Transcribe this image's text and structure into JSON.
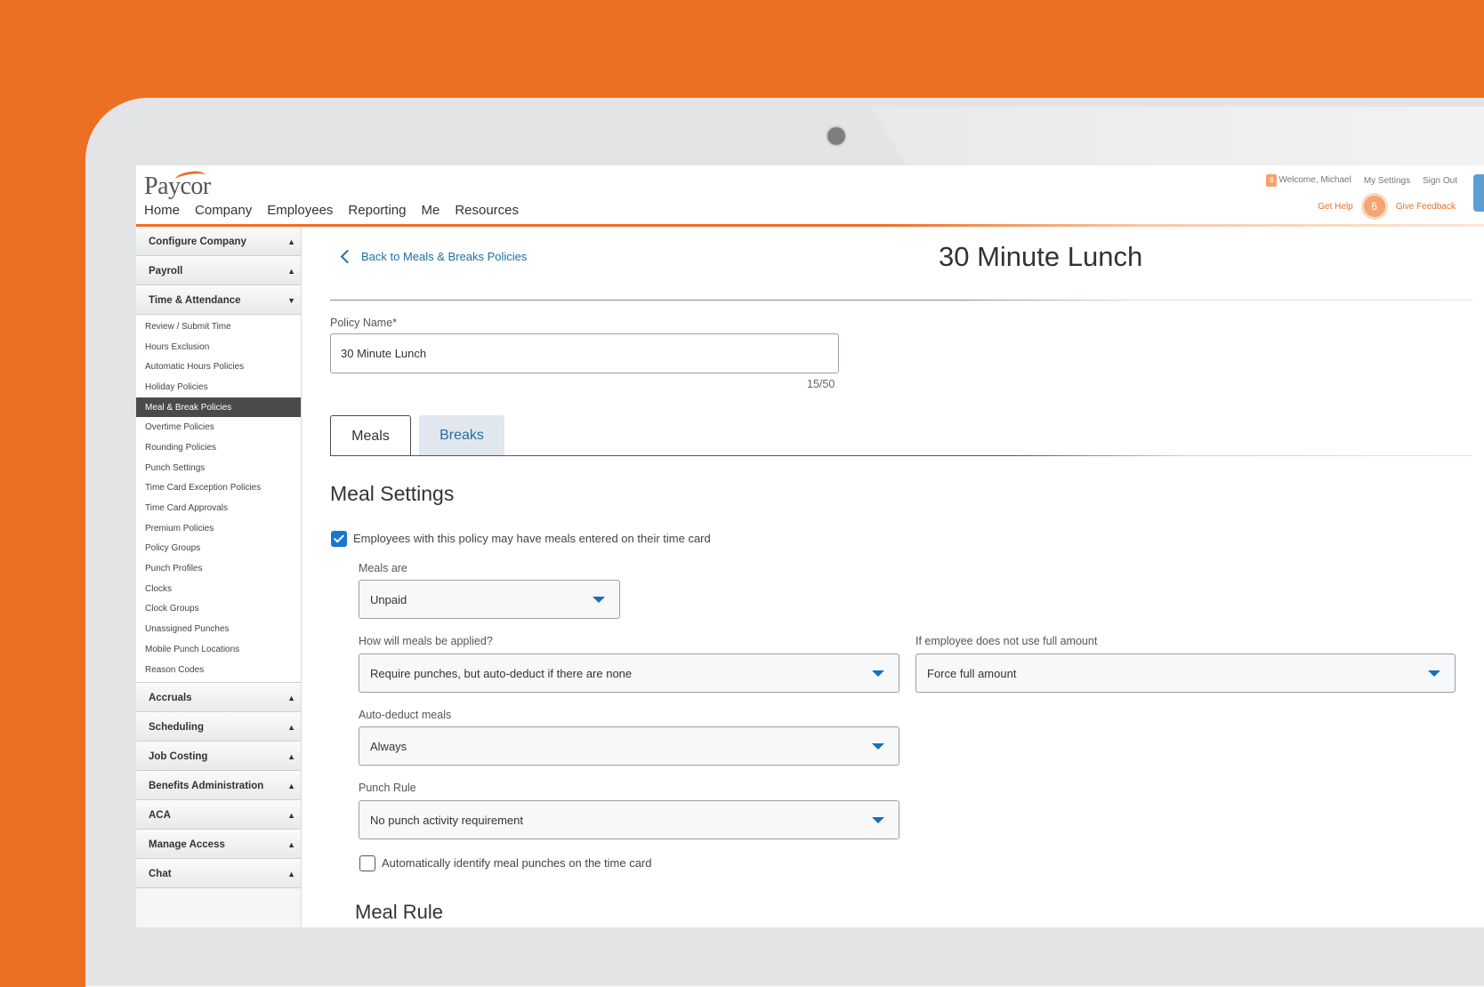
{
  "app": {
    "logo_text": "Paycor",
    "nav": [
      "Home",
      "Company",
      "Employees",
      "Reporting",
      "Me",
      "Resources"
    ],
    "notification_count": "8",
    "welcome": "Welcome, Michael",
    "my_settings": "My Settings",
    "sign_out": "Sign Out",
    "get_help": "Get Help",
    "help_count": "6",
    "give_feedback": "Give Feedback"
  },
  "sidebar": {
    "top_sections": [
      {
        "label": "Configure Company",
        "arrow": "▲"
      },
      {
        "label": "Payroll",
        "arrow": "▲"
      },
      {
        "label": "Time & Attendance",
        "arrow": "▼"
      }
    ],
    "time_items": [
      "Review / Submit Time",
      "Hours Exclusion",
      "Automatic Hours Policies",
      "Holiday Policies",
      "Meal & Break Policies",
      "Overtime Policies",
      "Rounding Policies",
      "Punch Settings",
      "Time Card Exception Policies",
      "Time Card Approvals",
      "Premium Policies",
      "Policy Groups",
      "Punch Profiles",
      "Clocks",
      "Clock Groups",
      "Unassigned Punches",
      "Mobile Punch Locations",
      "Reason Codes"
    ],
    "active_item": "Meal & Break Policies",
    "bottom_sections": [
      {
        "label": "Accruals",
        "arrow": "▲"
      },
      {
        "label": "Scheduling",
        "arrow": "▲"
      },
      {
        "label": "Job Costing",
        "arrow": "▲"
      },
      {
        "label": "Benefits Administration",
        "arrow": "▲"
      },
      {
        "label": "ACA",
        "arrow": "▲"
      },
      {
        "label": "Manage Access",
        "arrow": "▲"
      },
      {
        "label": "Chat",
        "arrow": "▲"
      }
    ]
  },
  "main": {
    "back_link": "Back to Meals & Breaks Policies",
    "title": "30 Minute Lunch",
    "policy_name_label": "Policy Name*",
    "policy_name_value": "30 Minute Lunch",
    "char_count": "15/50",
    "tabs": {
      "meals": "Meals",
      "breaks": "Breaks"
    },
    "meal_settings_heading": "Meal Settings",
    "meals_enabled_label": "Employees with this policy may have meals entered on their time card",
    "meals_are_label": "Meals are",
    "meals_are_value": "Unpaid",
    "applied_label": "How will meals be applied?",
    "applied_value": "Require punches, but auto-deduct if there are none",
    "full_amount_label": "If employee does not use full amount",
    "full_amount_value": "Force full amount",
    "auto_deduct_label": "Auto-deduct meals",
    "auto_deduct_value": "Always",
    "punch_rule_label": "Punch Rule",
    "punch_rule_value": "No punch activity requirement",
    "auto_identify_label": "Automatically identify meal punches on the time card",
    "meal_rule_heading": "Meal Rule"
  }
}
